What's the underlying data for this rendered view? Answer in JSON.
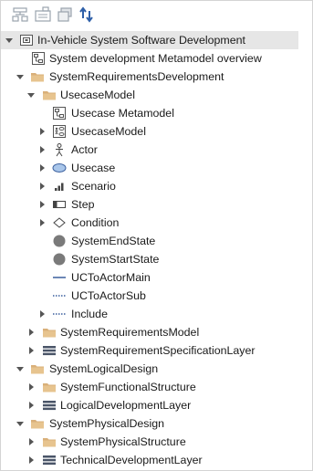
{
  "toolbar": {
    "buttons": [
      {
        "icon": "hierarchy-icon"
      },
      {
        "icon": "package-diagram-icon"
      },
      {
        "icon": "stacked-windows-icon"
      },
      {
        "icon": "sync-arrows-icon"
      }
    ]
  },
  "tree": {
    "root": "In-Vehicle System Software Development",
    "metamodel_overview": "System development Metamodel overview",
    "req_dev": "SystemRequirementsDevelopment",
    "usecase_model_pkg": "UsecaseModel",
    "usecase_metamodel": "Usecase Metamodel",
    "usecase_model": "UsecaseModel",
    "actor": "Actor",
    "usecase": "Usecase",
    "scenario": "Scenario",
    "step": "Step",
    "condition": "Condition",
    "end_state": "SystemEndState",
    "start_state": "SystemStartState",
    "uc_actor_main": "UCToActorMain",
    "uc_actor_sub": "UCToActorSub",
    "include": "Include",
    "req_model": "SystemRequirementsModel",
    "req_spec_layer": "SystemRequirementSpecificationLayer",
    "logical_design": "SystemLogicalDesign",
    "functional_structure": "SystemFunctionalStructure",
    "logical_dev_layer": "LogicalDevelopmentLayer",
    "physical_design": "SystemPhysicalDesign",
    "physical_structure": "SystemPhysicalStructure",
    "technical_dev_layer": "TechnicalDevelopmentLayer"
  },
  "colors": {
    "selection": "#e6e6e6",
    "folder": "#d9b07a",
    "accent_blue": "#3a5f9e",
    "state_gray": "#7a7a7a"
  }
}
